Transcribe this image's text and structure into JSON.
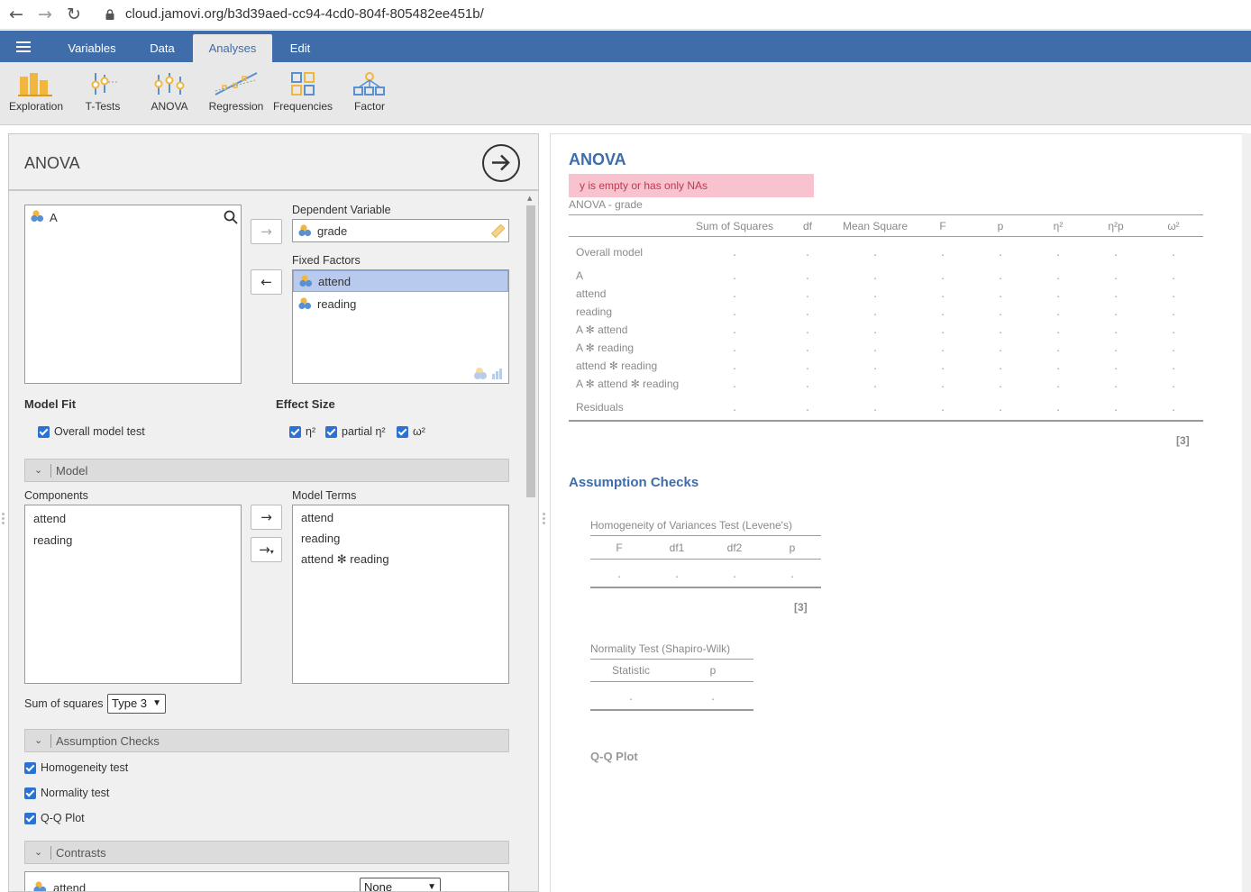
{
  "browser": {
    "url": "cloud.jamovi.org/b3d39aed-cc94-4cd0-804f-805482ee451b/"
  },
  "menubar": {
    "tabs": [
      "Variables",
      "Data",
      "Analyses",
      "Edit"
    ],
    "active_tab": "Analyses"
  },
  "ribbon": {
    "buttons": [
      "Exploration",
      "T-Tests",
      "ANOVA",
      "Regression",
      "Frequencies",
      "Factor"
    ]
  },
  "options": {
    "title": "ANOVA",
    "available_vars": [
      "A"
    ],
    "dependent_label": "Dependent Variable",
    "dependent_var": "grade",
    "fixed_factors_label": "Fixed Factors",
    "fixed_factors": [
      "attend",
      "reading"
    ],
    "model_fit_label": "Model Fit",
    "overall_model_test": "Overall model test",
    "effect_size_label": "Effect Size",
    "effect_sizes": [
      "η²",
      "partial η²",
      "ω²"
    ],
    "model_section": "Model",
    "components_label": "Components",
    "components": [
      "attend",
      "reading"
    ],
    "model_terms_label": "Model Terms",
    "model_terms": [
      "attend",
      "reading",
      "attend ✻ reading"
    ],
    "sum_of_squares_label": "Sum of squares",
    "sum_of_squares_value": "Type 3",
    "assumption_section": "Assumption Checks",
    "assumption_items": [
      "Homogeneity test",
      "Normality test",
      "Q-Q Plot"
    ],
    "contrasts_section": "Contrasts",
    "contrast_var": "attend",
    "contrast_value": "None"
  },
  "results": {
    "title": "ANOVA",
    "error": "y is empty or has only NAs",
    "table_title": "ANOVA - grade",
    "columns": [
      "Sum of Squares",
      "df",
      "Mean Square",
      "F",
      "p",
      "η²",
      "η²p",
      "ω²"
    ],
    "rows": [
      "Overall model",
      "A",
      "attend",
      "reading",
      "A ✻ attend",
      "A ✻ reading",
      "attend ✻ reading",
      "A ✻ attend ✻ reading",
      "Residuals"
    ],
    "cell": ".",
    "footnote_ref": "[3]",
    "assumption_title": "Assumption Checks",
    "levene_title": "Homogeneity of Variances Test (Levene's)",
    "levene_columns": [
      "F",
      "df1",
      "df2",
      "p"
    ],
    "levene_ref": "[3]",
    "normality_title": "Normality Test (Shapiro-Wilk)",
    "normality_columns": [
      "Statistic",
      "p"
    ],
    "qq_title": "Q-Q Plot"
  }
}
